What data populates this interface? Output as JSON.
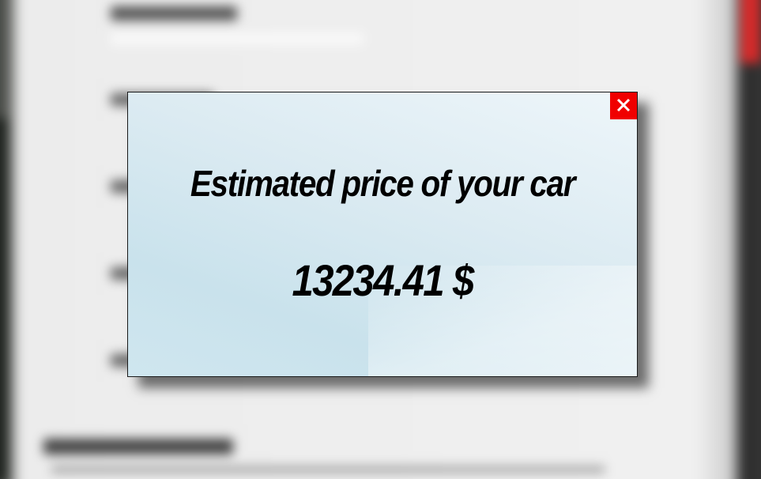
{
  "modal": {
    "title": "Estimated price of your car",
    "price": "13234.41 $",
    "close_icon": "close-icon",
    "close_button_color": "#f00000"
  }
}
